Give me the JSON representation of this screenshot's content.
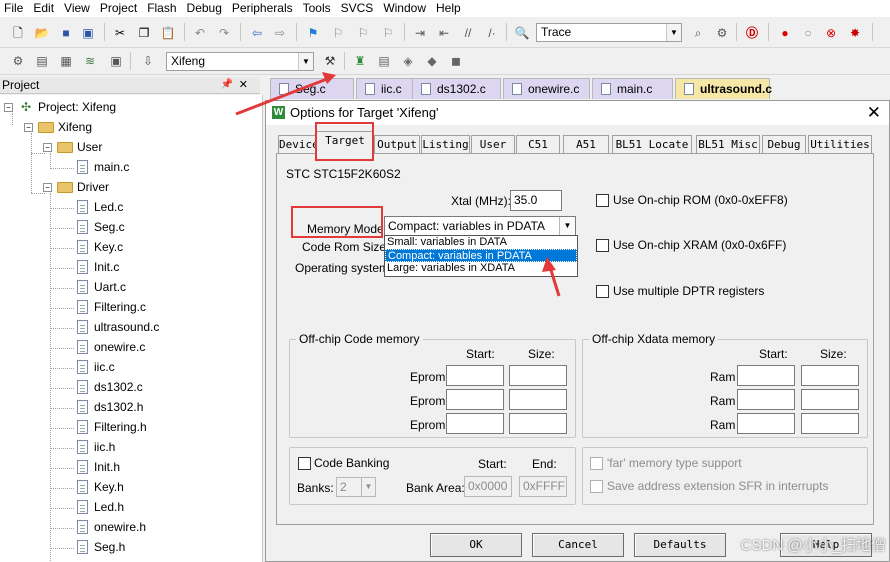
{
  "menu": [
    "File",
    "Edit",
    "View",
    "Project",
    "Flash",
    "Debug",
    "Peripherals",
    "Tools",
    "SVCS",
    "Window",
    "Help"
  ],
  "toolbar": {
    "find_combo": "Trace",
    "target_combo": "Xifeng",
    "icons": [
      "new-file-icon",
      "open-icon",
      "save-icon",
      "save-all-icon",
      "cut-icon",
      "copy-icon",
      "paste-icon",
      "undo-icon",
      "redo-icon",
      "back-icon",
      "forward-icon",
      "bookmark-icon",
      "prev-bookmark-icon",
      "next-bookmark-icon",
      "clear-bookmarks-icon",
      "indent-icon",
      "unindent-icon",
      "comment-icon",
      "uncomment-icon",
      "find-in-files-icon"
    ]
  },
  "project_panel": {
    "title": "Project",
    "tree": {
      "root": "Project: Xifeng",
      "target": "Xifeng",
      "groups": [
        {
          "name": "User",
          "files": [
            "main.c"
          ]
        },
        {
          "name": "Driver",
          "files": [
            "Led.c",
            "Seg.c",
            "Key.c",
            "Init.c",
            "Uart.c",
            "Filtering.c",
            "ultrasound.c",
            "onewire.c",
            "iic.c",
            "ds1302.c",
            "ds1302.h",
            "Filtering.h",
            "iic.h",
            "Init.h",
            "Key.h",
            "Led.h",
            "onewire.h",
            "Seg.h"
          ]
        }
      ]
    }
  },
  "editor_tabs": [
    {
      "label": "Seg.c",
      "active": false
    },
    {
      "label": "iic.c",
      "active": false
    },
    {
      "label": "ds1302.c",
      "active": false
    },
    {
      "label": "onewire.c",
      "active": false
    },
    {
      "label": "main.c",
      "active": false
    },
    {
      "label": "ultrasound.c",
      "active": true
    }
  ],
  "dialog": {
    "title": "Options for Target 'Xifeng'",
    "tabs": [
      "Device",
      "Target",
      "Output",
      "Listing",
      "User",
      "C51",
      "A51",
      "BL51 Locate",
      "BL51 Misc",
      "Debug",
      "Utilities"
    ],
    "selected_tab": "Target",
    "device": "STC STC15F2K60S2",
    "xtal_label": "Xtal (MHz):",
    "xtal_value": "35.0",
    "memory_model_label": "Memory Model:",
    "memory_model_value": "Compact: variables in PDATA",
    "memory_model_options": [
      "Small: variables in DATA",
      "Compact: variables in PDATA",
      "Large: variables in XDATA"
    ],
    "code_rom_label": "Code Rom Size:",
    "operating_system_label": "Operating system:",
    "use_onchip_rom": "Use On-chip ROM (0x0-0xEFF8)",
    "use_onchip_xram": "Use On-chip XRAM (0x0-0x6FF)",
    "use_multiple_dptr": "Use multiple DPTR registers",
    "code_memory_group": {
      "title": "Off-chip Code memory",
      "start_header": "Start:",
      "size_header": "Size:",
      "rows": [
        "Eprom",
        "Eprom",
        "Eprom"
      ]
    },
    "xdata_memory_group": {
      "title": "Off-chip Xdata memory",
      "start_header": "Start:",
      "size_header": "Size:",
      "rows": [
        "Ram",
        "Ram",
        "Ram"
      ]
    },
    "code_banking": {
      "label": "Code Banking",
      "start_header": "Start:",
      "end_header": "End:",
      "banks_label": "Banks:",
      "banks_value": "2",
      "bank_area_label": "Bank Area:",
      "bank_start": "0x0000",
      "bank_end": "0xFFFF"
    },
    "far_memory": "'far' memory type support",
    "save_address_ext": "Save address extension SFR in interrupts",
    "buttons": {
      "ok": "OK",
      "cancel": "Cancel",
      "defaults": "Defaults",
      "help": "Help"
    }
  },
  "watermark": "CSDN @小小_扫地僧",
  "colors": {
    "annotation": "#e23a3a",
    "selection": "#0078d7",
    "tab_active": "#f6e7a6",
    "tab_inactive": "#dcd6f0"
  }
}
